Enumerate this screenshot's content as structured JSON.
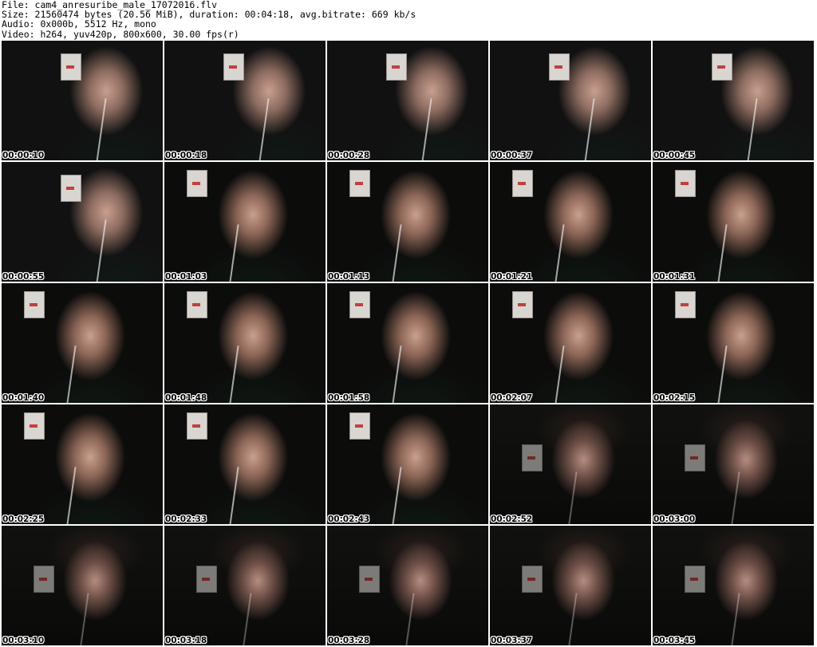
{
  "header": {
    "file": "File: cam4_anresuribe_male_17072016.flv",
    "size": "Size: 21560474 bytes (20.56 MiB), duration: 00:04:18, avg.bitrate: 669 kb/s",
    "audio": "Audio: 0x000b, 5512 Hz, mono",
    "video": "Video: h264, yuv420p, 800x600, 30.00 fps(r)"
  },
  "thumbnails": [
    {
      "time": "00:00:10",
      "variant": "a"
    },
    {
      "time": "00:00:18",
      "variant": "a"
    },
    {
      "time": "00:00:28",
      "variant": "a"
    },
    {
      "time": "00:00:37",
      "variant": "a"
    },
    {
      "time": "00:00:45",
      "variant": "a"
    },
    {
      "time": "00:00:55",
      "variant": "a"
    },
    {
      "time": "00:01:03",
      "variant": "b"
    },
    {
      "time": "00:01:13",
      "variant": "b"
    },
    {
      "time": "00:01:21",
      "variant": "b"
    },
    {
      "time": "00:01:31",
      "variant": "b"
    },
    {
      "time": "00:01:40",
      "variant": "b"
    },
    {
      "time": "00:01:48",
      "variant": "b"
    },
    {
      "time": "00:01:58",
      "variant": "b"
    },
    {
      "time": "00:02:07",
      "variant": "b"
    },
    {
      "time": "00:02:15",
      "variant": "b"
    },
    {
      "time": "00:02:25",
      "variant": "b"
    },
    {
      "time": "00:02:33",
      "variant": "b"
    },
    {
      "time": "00:02:43",
      "variant": "b"
    },
    {
      "time": "00:02:52",
      "variant": "c"
    },
    {
      "time": "00:03:00",
      "variant": "c"
    },
    {
      "time": "00:03:10",
      "variant": "c"
    },
    {
      "time": "00:03:18",
      "variant": "c"
    },
    {
      "time": "00:03:28",
      "variant": "c"
    },
    {
      "time": "00:03:37",
      "variant": "c"
    },
    {
      "time": "00:03:45",
      "variant": "c"
    }
  ]
}
